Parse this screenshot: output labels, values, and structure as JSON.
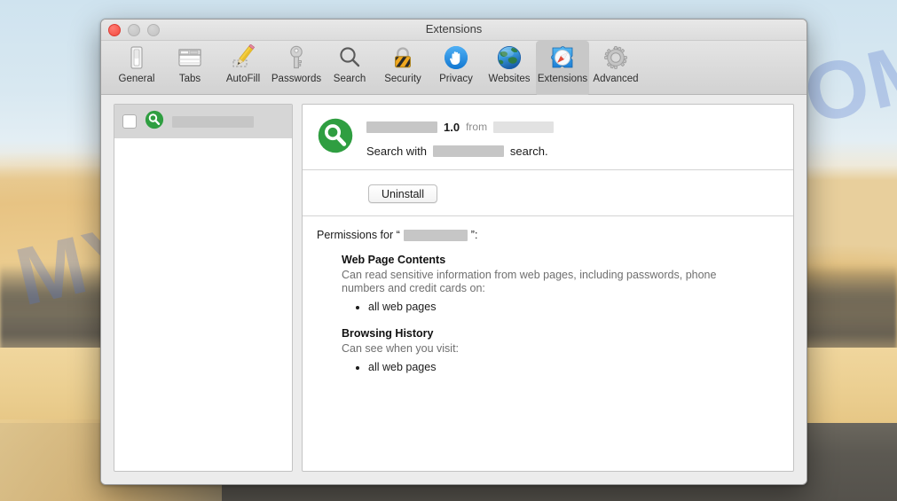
{
  "desktop": {
    "watermark": "MYANTISPYWARE.COM"
  },
  "window": {
    "title": "Extensions",
    "traffic_lights": [
      {
        "name": "close",
        "color": "#f34a3f"
      },
      {
        "name": "minimize",
        "color": "#c8c8c8"
      },
      {
        "name": "zoom",
        "color": "#c8c8c8"
      }
    ]
  },
  "toolbar": {
    "items": [
      {
        "label": "General",
        "icon": "general-icon",
        "selected": false
      },
      {
        "label": "Tabs",
        "icon": "tabs-icon",
        "selected": false
      },
      {
        "label": "AutoFill",
        "icon": "autofill-icon",
        "selected": false
      },
      {
        "label": "Passwords",
        "icon": "passwords-icon",
        "selected": false
      },
      {
        "label": "Search",
        "icon": "search-icon",
        "selected": false
      },
      {
        "label": "Security",
        "icon": "security-icon",
        "selected": false
      },
      {
        "label": "Privacy",
        "icon": "privacy-icon",
        "selected": false
      },
      {
        "label": "Websites",
        "icon": "websites-icon",
        "selected": false
      },
      {
        "label": "Extensions",
        "icon": "extensions-icon",
        "selected": true
      },
      {
        "label": "Advanced",
        "icon": "advanced-icon",
        "selected": false
      }
    ]
  },
  "extension_list": {
    "rows": [
      {
        "checked": false,
        "icon": "green-magnifier-icon",
        "name_redacted": true,
        "name_redacted_width": 92
      }
    ]
  },
  "detail": {
    "icon": "green-magnifier-icon",
    "name_redacted": true,
    "name_redacted_width": 80,
    "version": "1.0",
    "from_label": "from",
    "publisher_redacted": true,
    "publisher_redacted_width": 68,
    "description_prefix": "Search with",
    "description_redacted": true,
    "description_redacted_width": 80,
    "description_suffix": "search.",
    "uninstall_label": "Uninstall"
  },
  "permissions": {
    "heading_prefix": "Permissions for “",
    "heading_redacted": true,
    "heading_redacted_width": 72,
    "heading_suffix": "”:",
    "groups": [
      {
        "title": "Web Page Contents",
        "description": "Can read sensitive information from web pages, including passwords, phone numbers and credit cards on:",
        "items": [
          "all web pages"
        ]
      },
      {
        "title": "Browsing History",
        "description": "Can see when you visit:",
        "items": [
          "all web pages"
        ]
      }
    ]
  },
  "colors": {
    "accent_green": "#2f9e41",
    "accent_blue": "#1c8ce8",
    "toolbar_selected": "#c8c8c8",
    "window_chrome": "#ececec",
    "redaction": "#c6c6c6"
  }
}
